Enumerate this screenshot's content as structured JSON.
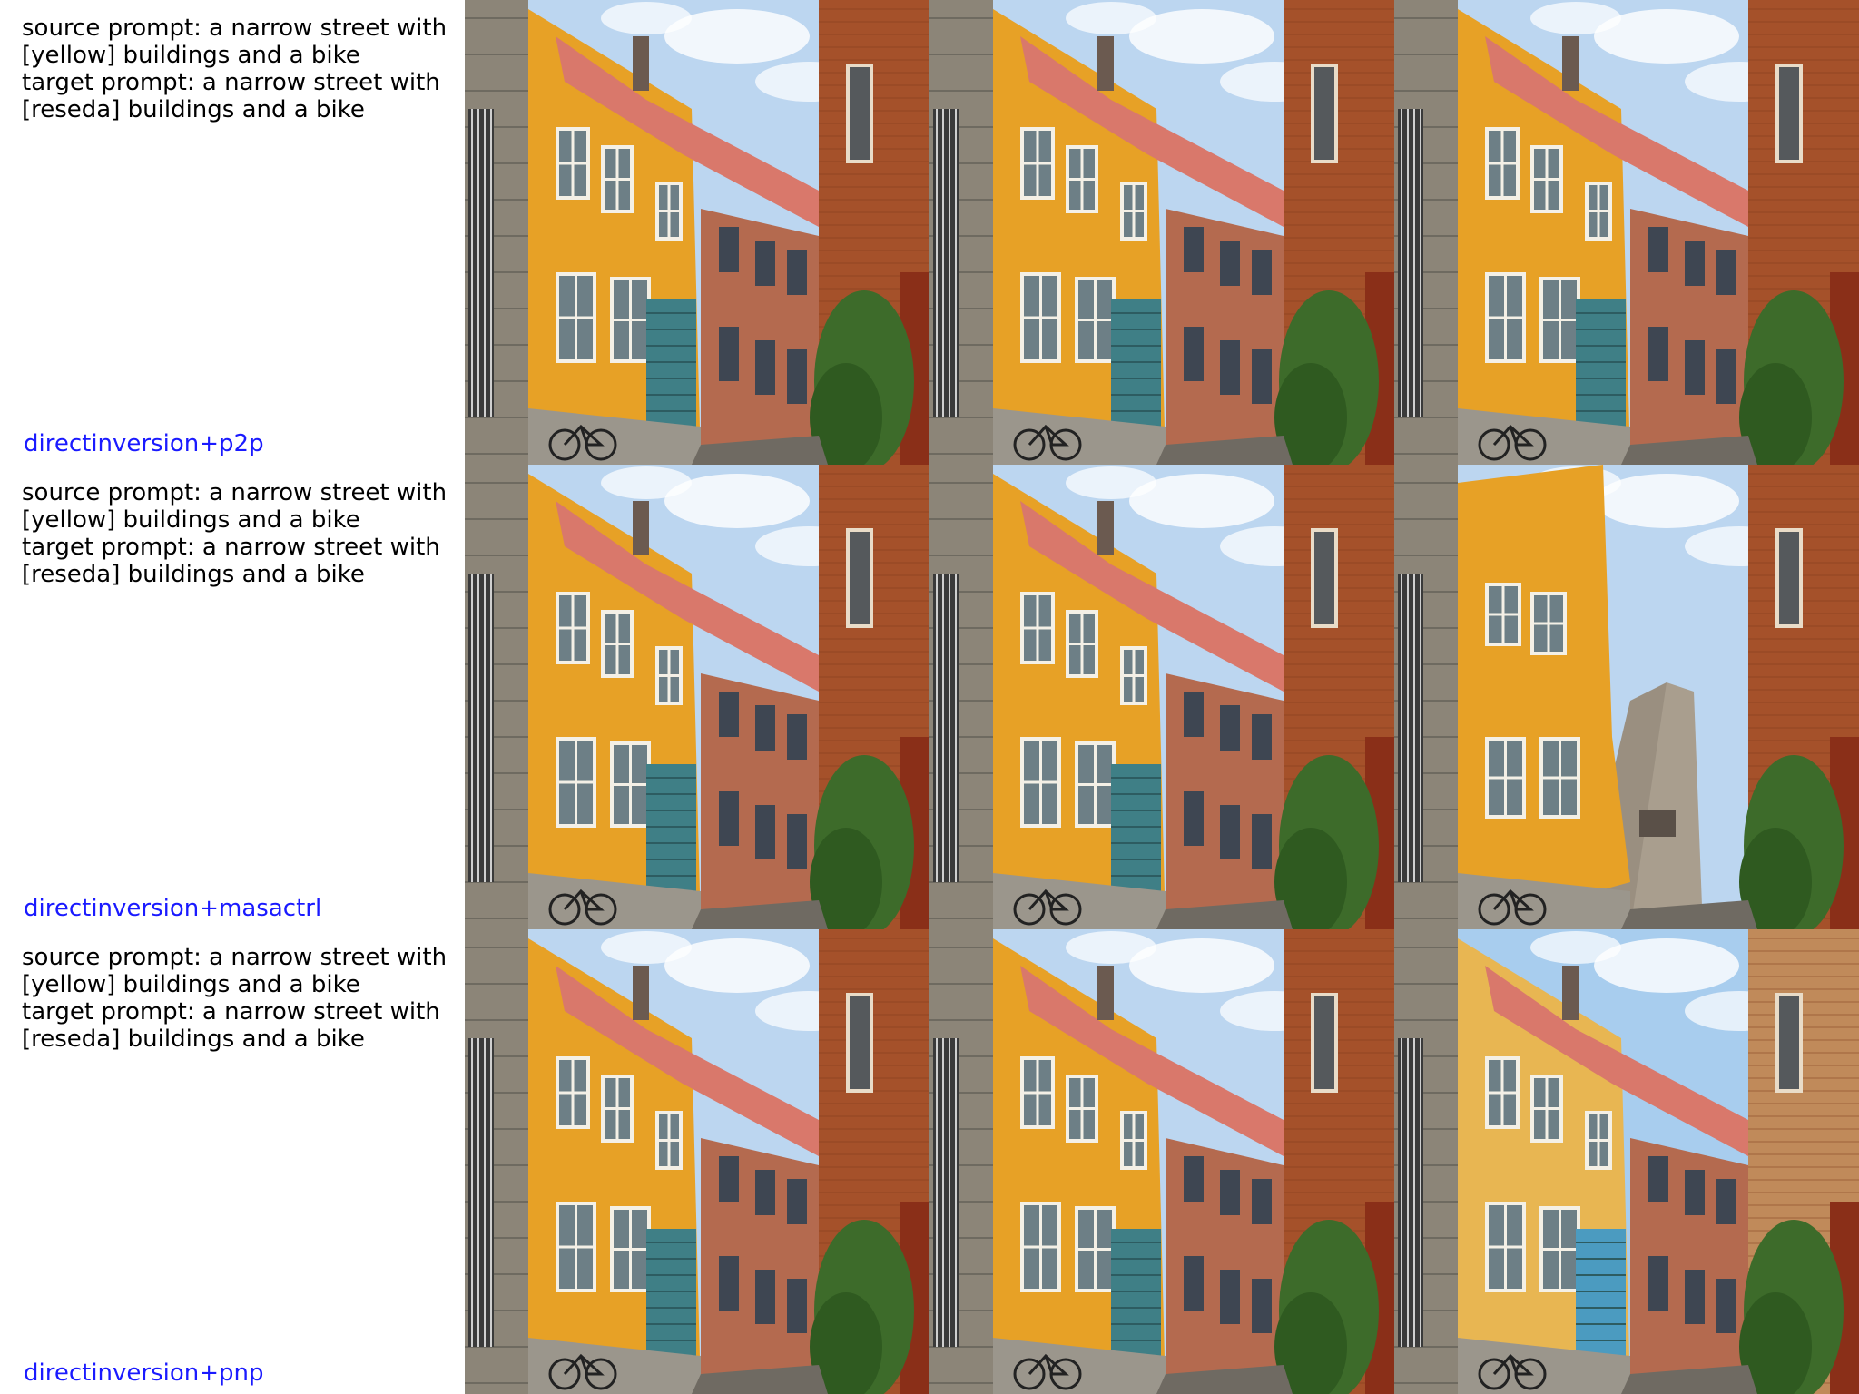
{
  "rows": [
    {
      "source_prompt": "source prompt: a narrow street with [yellow] buildings and a bike",
      "source_line1": "source prompt: a narrow street with",
      "source_line2": "[yellow] buildings and a bike",
      "target_line1": "target prompt: a narrow street with",
      "target_line2": "[reseda] buildings and a bike",
      "method": "directinversion+p2p",
      "panels": [
        "source-image",
        "reconstruction",
        "edited-image"
      ]
    },
    {
      "source_line1": "source prompt: a narrow street with",
      "source_line2": "[yellow] buildings and a bike",
      "target_line1": "target prompt: a narrow street with",
      "target_line2": "[reseda] buildings and a bike",
      "method": "directinversion+masactrl",
      "panels": [
        "source-image",
        "reconstruction",
        "edited-image"
      ]
    },
    {
      "source_line1": "source prompt: a narrow street with",
      "source_line2": "[yellow] buildings and a bike",
      "target_line1": "target prompt: a narrow street with",
      "target_line2": "[reseda] buildings and a bike",
      "method": "directinversion+pnp",
      "panels": [
        "source-image",
        "reconstruction",
        "edited-image"
      ]
    }
  ],
  "colors": {
    "method_label": "#1a1aff",
    "sky": "#bcd6f0",
    "cloud": "#ffffff",
    "yellow_wall": "#e7a126",
    "brick_wall": "#a5512a",
    "red_roof": "#d9786b",
    "teal_door": "#3f7f86",
    "ivy": "#3d6b2a",
    "stone": "#8c8578",
    "pale_yellow_wall": "#e8b652",
    "blue_door": "#4b9bc0"
  },
  "icons": [
    "street-photo-thumbnail"
  ]
}
